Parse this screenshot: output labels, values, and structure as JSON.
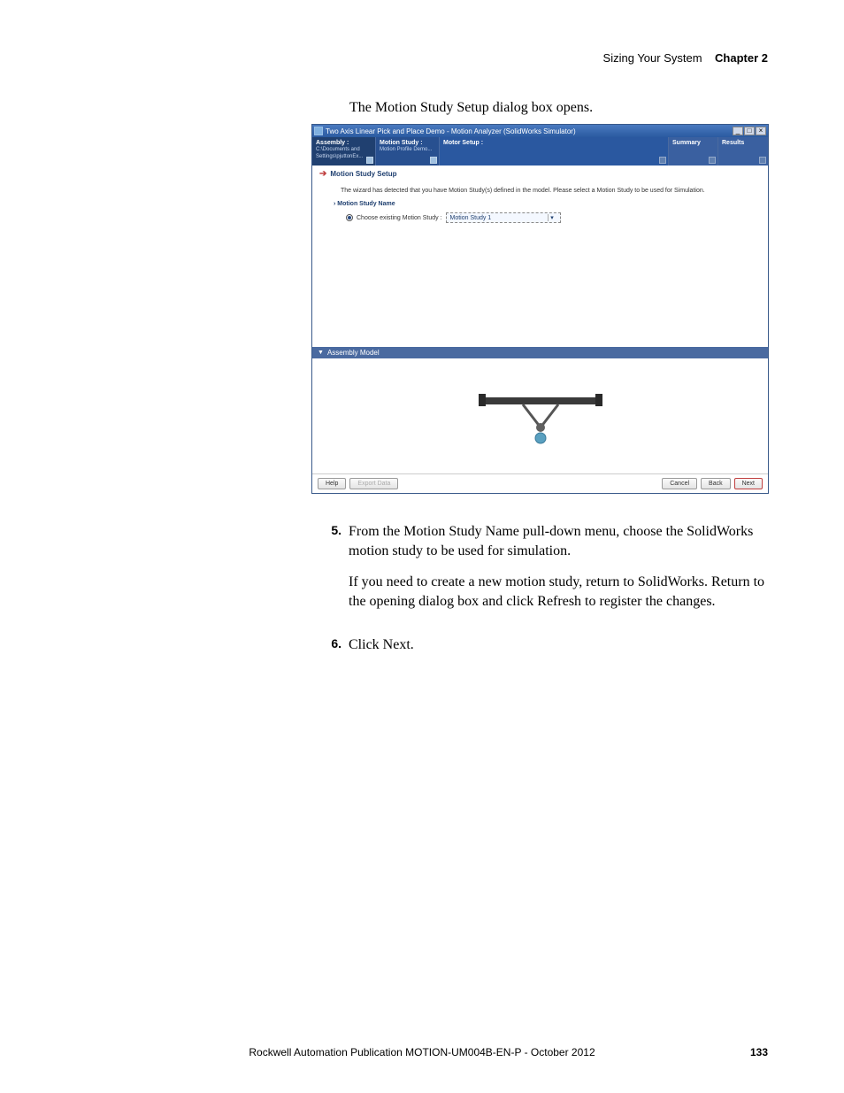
{
  "header": {
    "section": "Sizing Your System",
    "chapter": "Chapter 2"
  },
  "intro": "The Motion Study Setup dialog box opens.",
  "window": {
    "title": "Two Axis Linear Pick and Place Demo - Motion Analyzer  (SolidWorks Simulator)",
    "steps": {
      "assembly": {
        "title": "Assembly :",
        "sub": "C:\\Documents and Settings\\pjuttonEx..."
      },
      "motion_study": {
        "title": "Motion Study :",
        "sub": "Motion Profile Demo..."
      },
      "motor_setup": {
        "title": "Motor Setup :"
      },
      "summary": {
        "title": "Summary"
      },
      "results": {
        "title": "Results"
      }
    },
    "section_title": "Motion Study Setup",
    "hint": "The wizard has detected that you have Motion Study(s) defined in the model. Please select a Motion Study to be used for Simulation.",
    "subhead": "Motion Study Name",
    "radio_label": "Choose existing Motion Study :",
    "selected_study": "Motion Study 1",
    "assembly_label": "Assembly Model",
    "buttons": {
      "help": "Help",
      "export": "Export Data",
      "cancel": "Cancel",
      "back": "Back",
      "next": "Next"
    }
  },
  "steps": {
    "s5": {
      "num": "5.",
      "p1": "From the Motion Study Name pull-down menu, choose the SolidWorks motion study to be used for simulation.",
      "p2": "If you need to create a new motion study, return to SolidWorks. Return to the opening dialog box and click Refresh to register the changes."
    },
    "s6": {
      "num": "6.",
      "p1": "Click Next."
    }
  },
  "footer": {
    "pub": "Rockwell Automation Publication MOTION-UM004B-EN-P - October 2012",
    "page": "133"
  }
}
